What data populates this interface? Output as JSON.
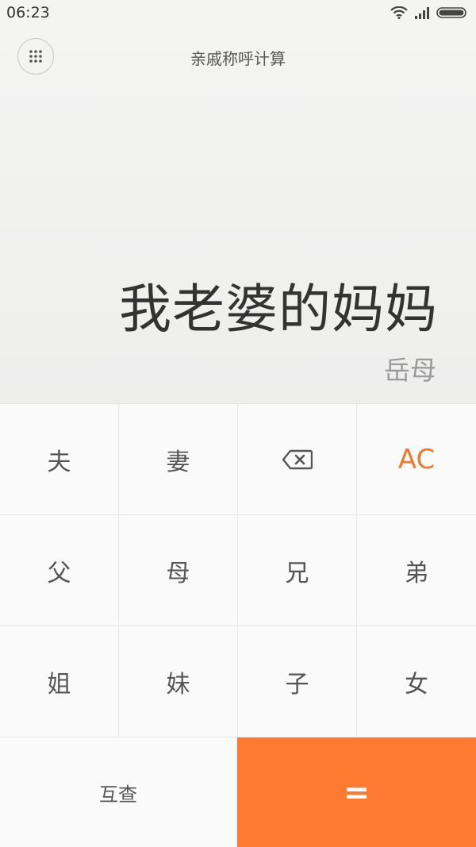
{
  "status_bar": {
    "time": "06:23"
  },
  "app": {
    "title": "亲戚称呼计算"
  },
  "display": {
    "expression": "我老婆的妈妈",
    "result": "岳母"
  },
  "keys": {
    "husband": "夫",
    "wife": "妻",
    "clear": "AC",
    "father": "父",
    "mother": "母",
    "elder_brother": "兄",
    "younger_brother": "弟",
    "elder_sister": "姐",
    "younger_sister": "妹",
    "son": "子",
    "daughter": "女",
    "cross_check": "互查",
    "equals": "="
  },
  "colors": {
    "accent": "#ff7a31",
    "ac_text": "#f0782f"
  },
  "icons": [
    "wifi-icon",
    "signal-icon",
    "battery-icon",
    "grid-menu-icon",
    "backspace-icon"
  ]
}
